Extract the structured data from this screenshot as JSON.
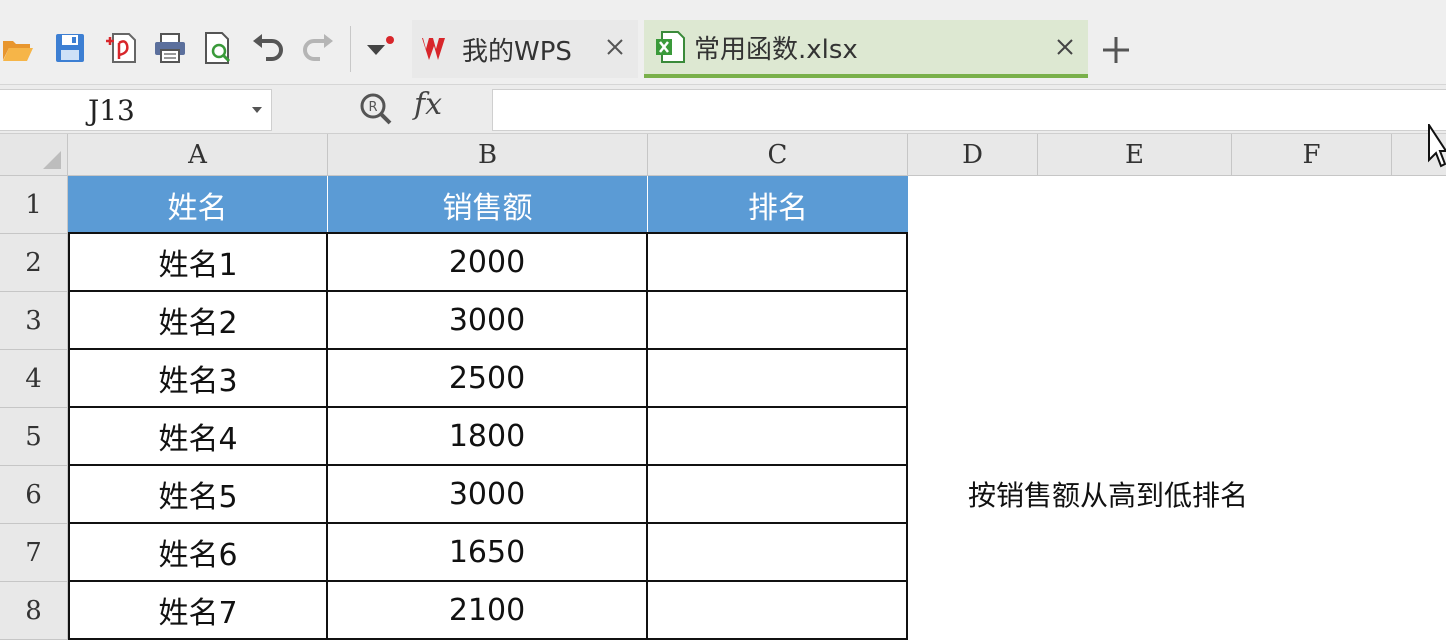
{
  "toolbar": {
    "icons": [
      "open-icon",
      "save-icon",
      "export-pdf-icon",
      "print-icon",
      "print-preview-icon",
      "undo-icon",
      "redo-icon",
      "customize-dropdown-icon"
    ],
    "tabs": [
      {
        "label": "我的WPS",
        "icon": "wps-logo-icon"
      },
      {
        "label": "常用函数.xlsx",
        "icon": "excel-file-icon"
      }
    ]
  },
  "formula_bar": {
    "name_box": "J13",
    "formula": ""
  },
  "columns": [
    "A",
    "B",
    "C",
    "D",
    "E",
    "F"
  ],
  "rows": [
    "1",
    "2",
    "3",
    "4",
    "5",
    "6",
    "7",
    "8"
  ],
  "table": {
    "headers": [
      "姓名",
      "销售额",
      "排名"
    ],
    "rows": [
      [
        "姓名1",
        "2000",
        ""
      ],
      [
        "姓名2",
        "3000",
        ""
      ],
      [
        "姓名3",
        "2500",
        ""
      ],
      [
        "姓名4",
        "1800",
        ""
      ],
      [
        "姓名5",
        "3000",
        ""
      ],
      [
        "姓名6",
        "1650",
        ""
      ],
      [
        "姓名7",
        "2100",
        ""
      ]
    ]
  },
  "note": "按销售额从高到低排名",
  "colors": {
    "header_fill": "#5b9bd5",
    "header_text": "#ffffff",
    "active_tab_fill": "#dde8d2",
    "active_tab_accent": "#79b04a",
    "wps_red": "#d8262b"
  }
}
